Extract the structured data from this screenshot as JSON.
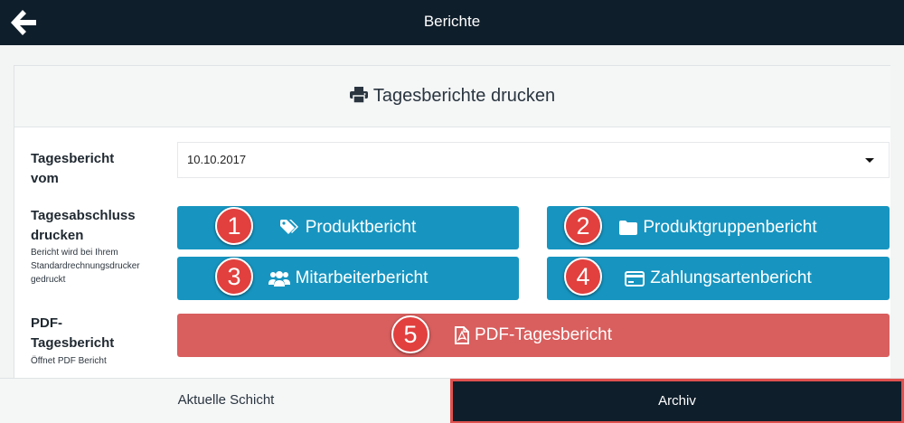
{
  "header": {
    "title": "Berichte",
    "back_icon": "arrow-left-icon"
  },
  "panel": {
    "title": "Tagesberichte drucken",
    "title_icon": "printer-icon"
  },
  "date_row": {
    "label_line1": "Tagesbericht",
    "label_line2": "vom",
    "selected_value": "10.10.2017"
  },
  "print_row": {
    "label_line1": "Tagesabschluss",
    "label_line2": "drucken",
    "hint_line1": "Bericht wird bei Ihrem",
    "hint_line2": "Standardrechnungsdrucker",
    "hint_line3": "gedruckt",
    "buttons": [
      {
        "label": "Produktbericht",
        "icon": "tags-icon",
        "badge": "1"
      },
      {
        "label": "Produktgruppenbericht",
        "icon": "folder-icon",
        "badge": "2"
      },
      {
        "label": "Mitarbeiterbericht",
        "icon": "users-icon",
        "badge": "3"
      },
      {
        "label": "Zahlungsartenbericht",
        "icon": "credit-card-icon",
        "badge": "4"
      }
    ]
  },
  "pdf_row": {
    "label_line1": "PDF-",
    "label_line2": "Tagesbericht",
    "hint": "Öffnet PDF Bericht",
    "button_label": "PDF-Tagesbericht",
    "button_icon": "file-pdf-icon",
    "badge": "5"
  },
  "bottom_tabs": {
    "current_shift": "Aktuelle Schicht",
    "archive": "Archiv"
  },
  "colors": {
    "header_bg": "#0f1e2b",
    "primary_button": "#1795c0",
    "pdf_button": "#d85f5e",
    "badge": "#e1403e",
    "highlight_border": "#e0514f"
  }
}
